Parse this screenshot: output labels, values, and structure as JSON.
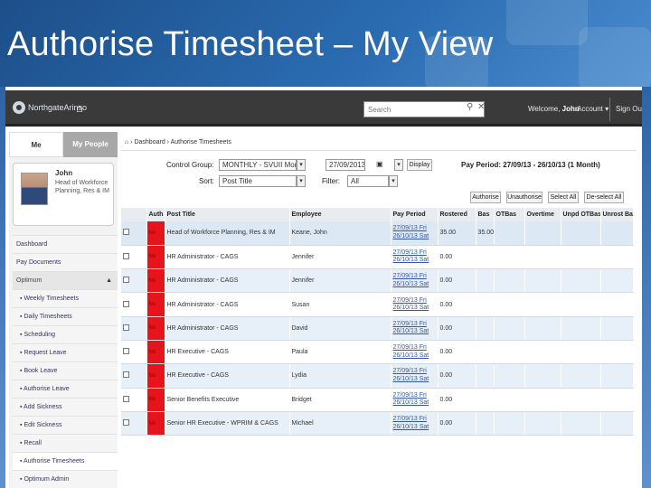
{
  "slide": {
    "title": "Authorise Timesheet – My View"
  },
  "topbar": {
    "logo_text": "NorthgateArinso",
    "search_placeholder": "Search",
    "welcome_prefix": "Welcome,",
    "user": "John",
    "account_label": "Account",
    "signout_label": "Sign Out"
  },
  "sidebar": {
    "tab_me": "Me",
    "tab_people": "My People",
    "profile_name": "John",
    "profile_role": "Head of Workforce Planning, Res & IM",
    "dashboard": "Dashboard",
    "pay_documents": "Pay Documents",
    "optimum": "Optimum",
    "items": [
      "Weekly Timesheets",
      "Daily Timesheets",
      "Scheduling",
      "Request Leave",
      "Book Leave",
      "Authorise Leave",
      "Add Sickness",
      "Edit Sickness",
      "Recall",
      "Authorise Timesheets",
      "Optimum Admin"
    ]
  },
  "breadcrumb": {
    "home": "⌂",
    "dashboard": "Dashboard",
    "current": "Authorise Timesheets"
  },
  "controls": {
    "control_group_label": "Control Group:",
    "control_group_value": "MONTHLY - SVUII Month",
    "date_value": "27/09/2013",
    "display_label": "Display",
    "pay_period": "Pay Period: 27/09/13 - 26/10/13 (1 Month)",
    "sort_label": "Sort:",
    "sort_value": "Post Title",
    "filter_label": "Filter:",
    "filter_value": "All",
    "buttons": [
      "Authorise",
      "Unauthorise",
      "Select All",
      "De-select All"
    ]
  },
  "table": {
    "columns": [
      "",
      "Auth",
      "Post Title",
      "Employee",
      "Pay Period",
      "Rostered",
      "Bas",
      "OTBas",
      "Overtime",
      "Unpd OTBas",
      "Unrost Bas"
    ],
    "rows": [
      {
        "auth": "No",
        "post": "Head of Workforce Planning, Res & IM",
        "employee": "Keane, John",
        "p1": "27/09/13 Fri",
        "p2": "26/10/13 Sat",
        "rostered": "35.00",
        "bas": "35.00"
      },
      {
        "auth": "No",
        "post": "HR Administrator - CAGS",
        "employee": "Jennifer",
        "p1": "27/09/13 Fri",
        "p2": "26/10/13 Sat",
        "rostered": "0.00",
        "bas": ""
      },
      {
        "auth": "No",
        "post": "HR Administrator - CAGS",
        "employee": "Jennifer",
        "p1": "27/09/13 Fri",
        "p2": "26/10/13 Sat",
        "rostered": "0.00",
        "bas": ""
      },
      {
        "auth": "No",
        "post": "HR Administrator - CAGS",
        "employee": "Susan",
        "p1": "27/09/13 Fri",
        "p2": "26/10/13 Sat",
        "rostered": "0.00",
        "bas": ""
      },
      {
        "auth": "No",
        "post": "HR Administrator - CAGS",
        "employee": "David",
        "p1": "27/09/13 Fri",
        "p2": "26/10/13 Sat",
        "rostered": "0.00",
        "bas": ""
      },
      {
        "auth": "No",
        "post": "HR Executive - CAGS",
        "employee": "Paula",
        "p1": "27/09/13 Fri",
        "p2": "26/10/13 Sat",
        "rostered": "0.00",
        "bas": ""
      },
      {
        "auth": "No",
        "post": "HR Executive - CAGS",
        "employee": "Lydia",
        "p1": "27/09/13 Fri",
        "p2": "26/10/13 Sat",
        "rostered": "0.00",
        "bas": ""
      },
      {
        "auth": "No",
        "post": "Senior Benefits Executive",
        "employee": "Bridget",
        "p1": "27/09/13 Fri",
        "p2": "26/10/13 Sat",
        "rostered": "0.00",
        "bas": ""
      },
      {
        "auth": "No",
        "post": "Senior HR Executive - WPRIM & CAGS",
        "employee": "Michael",
        "p1": "27/09/13 Fri",
        "p2": "26/10/13 Sat",
        "rostered": "0.00",
        "bas": ""
      }
    ]
  },
  "colors": {
    "auth_red": "#e8141c",
    "header_blue": "#1d4f8a",
    "topbar": "#3a3a3a"
  }
}
